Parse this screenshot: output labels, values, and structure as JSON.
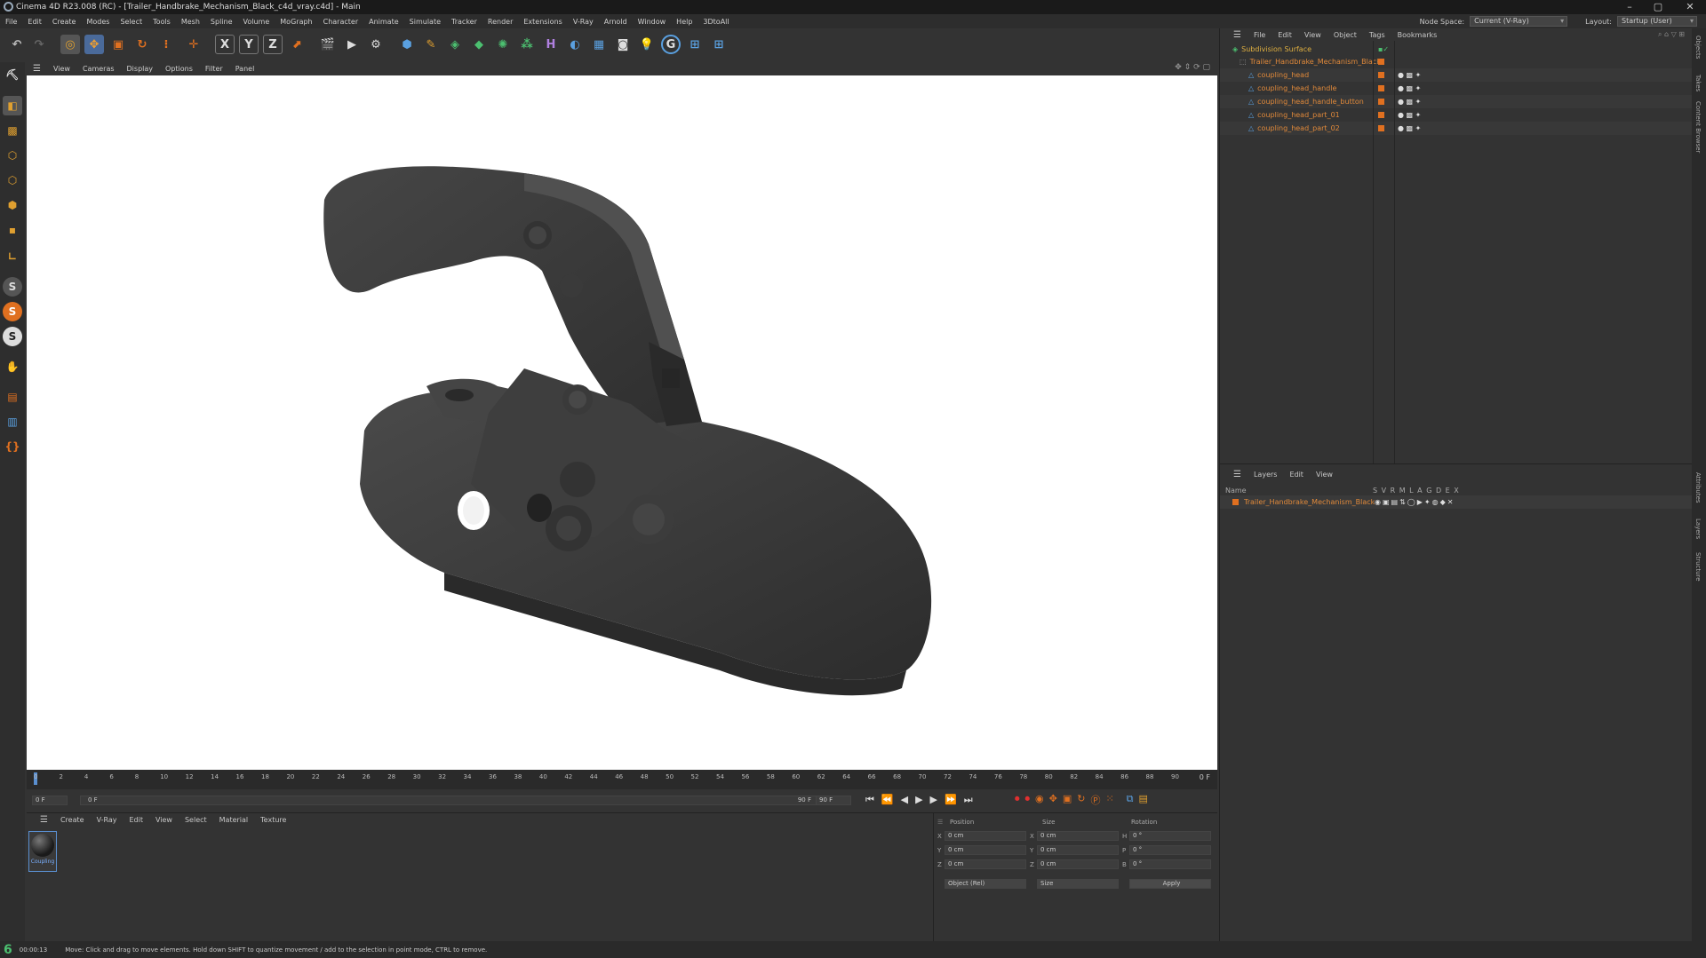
{
  "window": {
    "title": "Cinema 4D R23.008 (RC) - [Trailer_Handbrake_Mechanism_Black_c4d_vray.c4d] - Main",
    "minimize": "–",
    "maximize": "▢",
    "close": "✕"
  },
  "menubar": {
    "items": [
      "File",
      "Edit",
      "Create",
      "Modes",
      "Select",
      "Tools",
      "Mesh",
      "Spline",
      "Volume",
      "MoGraph",
      "Character",
      "Animate",
      "Simulate",
      "Tracker",
      "Render",
      "Extensions",
      "V-Ray",
      "Arnold",
      "Window",
      "Help",
      "3DtoAll"
    ],
    "node_space_label": "Node Space:",
    "node_space_value": "Current (V-Ray)",
    "layout_label": "Layout:",
    "layout_value": "Startup (User)"
  },
  "viewport": {
    "menu": [
      "View",
      "Cameras",
      "Display",
      "Options",
      "Filter",
      "Panel"
    ]
  },
  "timeline": {
    "ticks": [
      "0",
      "2",
      "4",
      "6",
      "8",
      "10",
      "12",
      "14",
      "16",
      "18",
      "20",
      "22",
      "24",
      "26",
      "28",
      "30",
      "32",
      "34",
      "36",
      "38",
      "40",
      "42",
      "44",
      "46",
      "48",
      "50",
      "52",
      "54",
      "56",
      "58",
      "60",
      "62",
      "64",
      "66",
      "68",
      "70",
      "72",
      "74",
      "76",
      "78",
      "80",
      "82",
      "84",
      "86",
      "88",
      "90"
    ],
    "current_frame": "0 F"
  },
  "transport": {
    "start_field": "0 F",
    "range_start": "0 F",
    "range_end": "90 F",
    "end_field": "90 F"
  },
  "material_manager": {
    "menu": [
      "Create",
      "V-Ray",
      "Edit",
      "View",
      "Select",
      "Material",
      "Texture"
    ],
    "materials": [
      {
        "name": "Coupling"
      }
    ]
  },
  "attributes": {
    "headers": {
      "position": "Position",
      "size": "Size",
      "rotation": "Rotation"
    },
    "rows": [
      {
        "axis": "X",
        "pos": "0 cm",
        "size_axis": "X",
        "size": "0 cm",
        "rot_axis": "H",
        "rot": "0 °"
      },
      {
        "axis": "Y",
        "pos": "0 cm",
        "size_axis": "Y",
        "size": "0 cm",
        "rot_axis": "P",
        "rot": "0 °"
      },
      {
        "axis": "Z",
        "pos": "0 cm",
        "size_axis": "Z",
        "size": "0 cm",
        "rot_axis": "B",
        "rot": "0 °"
      }
    ],
    "mode_dropdown": "Object (Rel)",
    "size_dropdown": "Size",
    "apply_label": "Apply"
  },
  "object_manager": {
    "menu": [
      "File",
      "Edit",
      "View",
      "Object",
      "Tags",
      "Bookmarks"
    ],
    "objects": [
      {
        "name": "Subdivision Surface"
      },
      {
        "name": "Trailer_Handbrake_Mechanism_Black"
      },
      {
        "name": "coupling_head"
      },
      {
        "name": "coupling_head_handle"
      },
      {
        "name": "coupling_head_handle_button"
      },
      {
        "name": "coupling_head_part_01"
      },
      {
        "name": "coupling_head_part_02"
      }
    ]
  },
  "layers_manager": {
    "menu": [
      "Layers",
      "Edit",
      "View"
    ],
    "col_name": "Name",
    "col_flags": "S V R M L A G D E X",
    "layers": [
      {
        "name": "Trailer_Handbrake_Mechanism_Black"
      }
    ]
  },
  "right_tabs": [
    "Objects",
    "Takes",
    "Content Browser",
    "Attributes",
    "Layers",
    "Structure"
  ],
  "status": {
    "time": "00:00:13",
    "message": "Move: Click and drag to move elements. Hold down SHIFT to quantize movement / add to the selection in point mode, CTRL to remove."
  },
  "colors": {
    "accent_orange": "#e07020",
    "object_text": "#e0893a",
    "viewport_bg": "#ffffff",
    "model": "#3b3b3b"
  }
}
